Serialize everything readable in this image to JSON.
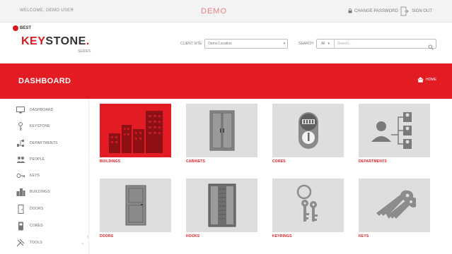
{
  "topbar": {
    "welcome": "WELCOME, DEMO USER",
    "demo": "DEMO",
    "change_password": "CHANGE PASSWORD",
    "sign_out": "SIGN OUT"
  },
  "header": {
    "badge": "BEST",
    "logo_key": "KEY",
    "logo_stone": "STONE",
    "logo_suffix": ".",
    "logo_sub": "SERIES",
    "location_label": "CLIENT SITE",
    "location_value": "Demo Location",
    "search_label": "SEARCH",
    "search_scope": "All",
    "search_placeholder": "Search..."
  },
  "banner": {
    "title": "DASHBOARD",
    "home": "HOME"
  },
  "sidebar": {
    "items": [
      {
        "label": "DASHBOARD",
        "icon": "dashboard-icon"
      },
      {
        "label": "KEYSTONE",
        "icon": "key-icon"
      },
      {
        "label": "DEPARTMENTS",
        "icon": "departments-icon"
      },
      {
        "label": "PEOPLE",
        "icon": "people-icon"
      },
      {
        "label": "KEYS",
        "icon": "keys-icon"
      },
      {
        "label": "BUILDINGS",
        "icon": "buildings-icon"
      },
      {
        "label": "DOORS",
        "icon": "door-icon"
      },
      {
        "label": "CORES",
        "icon": "core-icon"
      },
      {
        "label": "TOOLS",
        "icon": "tools-icon"
      }
    ]
  },
  "tiles": [
    {
      "label": "BUILDINGS",
      "icon": "buildings-icon",
      "active": true
    },
    {
      "label": "CABINETS",
      "icon": "cabinet-icon",
      "active": false
    },
    {
      "label": "CORES",
      "icon": "core-icon",
      "active": false
    },
    {
      "label": "DEPARTMENTS",
      "icon": "departments-icon",
      "active": false
    },
    {
      "label": "DOORS",
      "icon": "door-icon",
      "active": false
    },
    {
      "label": "HOOKS",
      "icon": "hooks-icon",
      "active": false
    },
    {
      "label": "KEYRINGS",
      "icon": "keyring-icon",
      "active": false
    },
    {
      "label": "KEYS",
      "icon": "keys-icon",
      "active": false
    }
  ],
  "colors": {
    "accent": "#e31b23",
    "tile_bg": "#dedede",
    "icon_gray": "#7a7a7a"
  }
}
